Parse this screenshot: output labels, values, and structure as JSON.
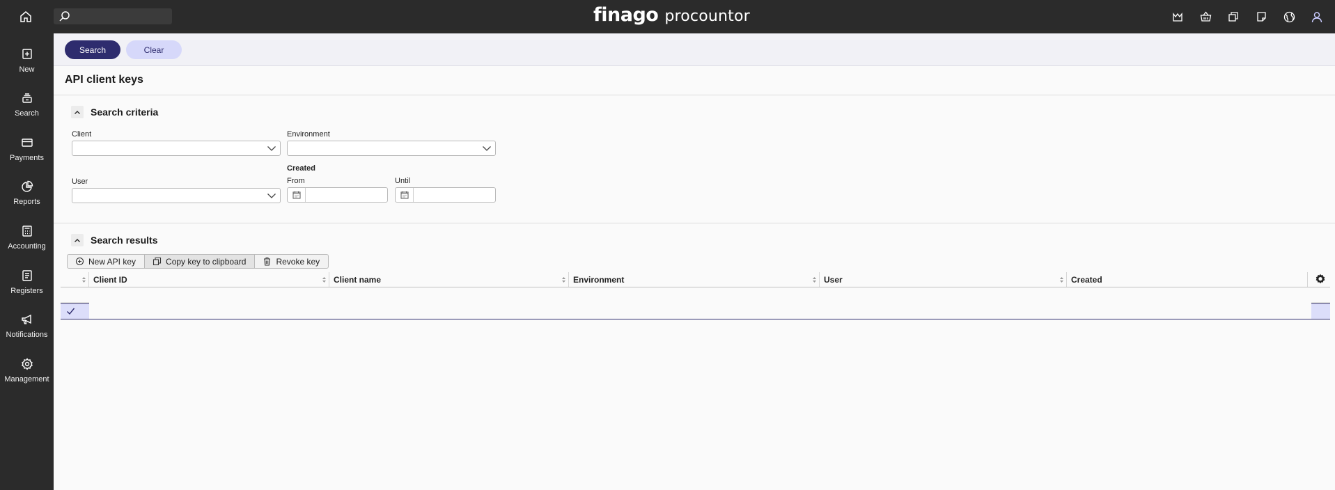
{
  "topbar": {
    "search": {
      "value": "",
      "placeholder": ""
    },
    "brand": {
      "primary": "finago",
      "secondary": "procountor"
    },
    "icons": [
      "notifications-crown-icon",
      "basket-icon",
      "copy-window-icon",
      "document-icon",
      "globe-icon",
      "user-icon"
    ]
  },
  "sidebar": {
    "items": [
      {
        "label": "New",
        "icon": "plus-box-icon"
      },
      {
        "label": "Search",
        "icon": "search-stack-icon"
      },
      {
        "label": "Payments",
        "icon": "card-icon"
      },
      {
        "label": "Reports",
        "icon": "pie-chart-icon"
      },
      {
        "label": "Accounting",
        "icon": "calculator-icon"
      },
      {
        "label": "Registers",
        "icon": "register-icon"
      },
      {
        "label": "Notifications",
        "icon": "megaphone-icon"
      },
      {
        "label": "Management",
        "icon": "gear-icon"
      }
    ]
  },
  "actions": {
    "search_label": "Search",
    "clear_label": "Clear"
  },
  "page": {
    "title": "API client keys"
  },
  "criteria": {
    "title": "Search criteria",
    "client_label": "Client",
    "client_value": "",
    "environment_label": "Environment",
    "environment_value": "",
    "user_label": "User",
    "user_value": "",
    "created_label": "Created",
    "from_label": "From",
    "from_value": "",
    "until_label": "Until",
    "until_value": ""
  },
  "results": {
    "title": "Search results",
    "toolbar": {
      "new_label": "New API key",
      "copy_label": "Copy key to clipboard",
      "revoke_label": "Revoke key"
    },
    "columns": [
      "Client ID",
      "Client name",
      "Environment",
      "User",
      "Created"
    ],
    "rows": [
      {
        "selected": false,
        "cells": [
          "",
          "",
          "",
          "",
          ""
        ]
      },
      {
        "selected": true,
        "cells": [
          "",
          "",
          "",
          "",
          ""
        ]
      }
    ]
  },
  "colors": {
    "primary": "#2e2c6e",
    "secondary": "#d6d8fa",
    "dark": "#2b2b2b"
  }
}
